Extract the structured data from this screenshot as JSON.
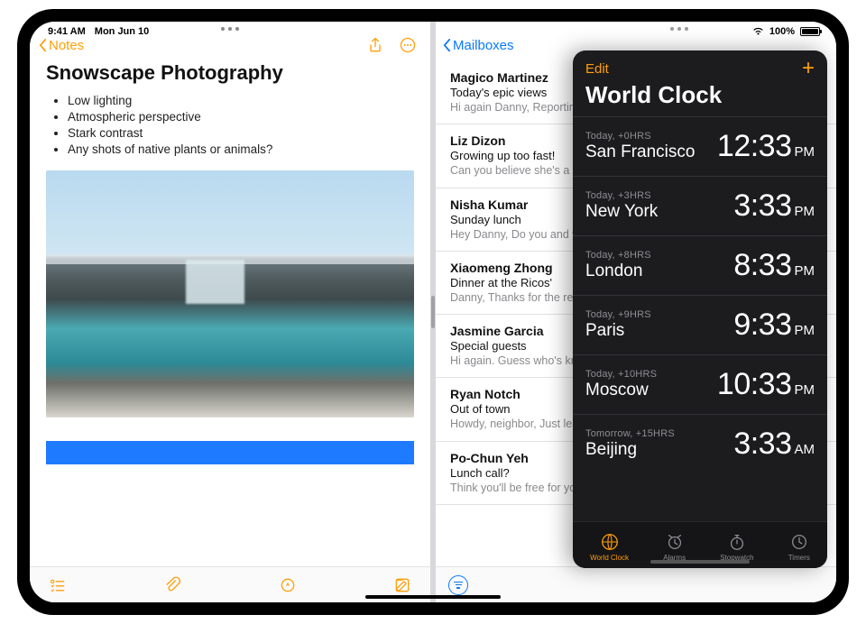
{
  "status": {
    "time": "9:41 AM",
    "date": "Mon Jun 10",
    "battery_pct": "100%"
  },
  "notes": {
    "back_label": "Notes",
    "title": "Snowscape Photography",
    "bullets": [
      "Low lighting",
      "Atmospheric perspective",
      "Stark contrast",
      "Any shots of native plants or animals?"
    ]
  },
  "mail": {
    "back_label": "Mailboxes",
    "items": [
      {
        "from": "Magico Martinez",
        "subject": "Today's epic views",
        "preview": "Hi again Danny, Reporting back on today. Wide open skies, a gen"
      },
      {
        "from": "Liz Dizon",
        "subject": "Growing up too fast!",
        "preview": "Can you believe she's a"
      },
      {
        "from": "Nisha Kumar",
        "subject": "Sunday lunch",
        "preview": "Hey Danny, Do you and your dad? If you two join, th"
      },
      {
        "from": "Xiaomeng Zhong",
        "subject": "Dinner at the Ricos'",
        "preview": "Danny, Thanks for the remembered to take on"
      },
      {
        "from": "Jasmine Garcia",
        "subject": "Special guests",
        "preview": "Hi again. Guess who's know how to make me"
      },
      {
        "from": "Ryan Notch",
        "subject": "Out of town",
        "preview": "Howdy, neighbor, Just leaving Tuesday and w"
      },
      {
        "from": "Po-Chun Yeh",
        "subject": "Lunch call?",
        "preview": "Think you'll be free for you think might work a"
      }
    ]
  },
  "clock": {
    "edit_label": "Edit",
    "title": "World Clock",
    "rows": [
      {
        "offset": "Today, +0HRS",
        "city": "San Francisco",
        "time": "12:33",
        "ampm": "PM"
      },
      {
        "offset": "Today, +3HRS",
        "city": "New York",
        "time": "3:33",
        "ampm": "PM"
      },
      {
        "offset": "Today, +8HRS",
        "city": "London",
        "time": "8:33",
        "ampm": "PM"
      },
      {
        "offset": "Today, +9HRS",
        "city": "Paris",
        "time": "9:33",
        "ampm": "PM"
      },
      {
        "offset": "Today, +10HRS",
        "city": "Moscow",
        "time": "10:33",
        "ampm": "PM"
      },
      {
        "offset": "Tomorrow, +15HRS",
        "city": "Beijing",
        "time": "3:33",
        "ampm": "AM"
      }
    ],
    "tabs": [
      {
        "name": "World Clock"
      },
      {
        "name": "Alarms"
      },
      {
        "name": "Stopwatch"
      },
      {
        "name": "Timers"
      }
    ]
  }
}
